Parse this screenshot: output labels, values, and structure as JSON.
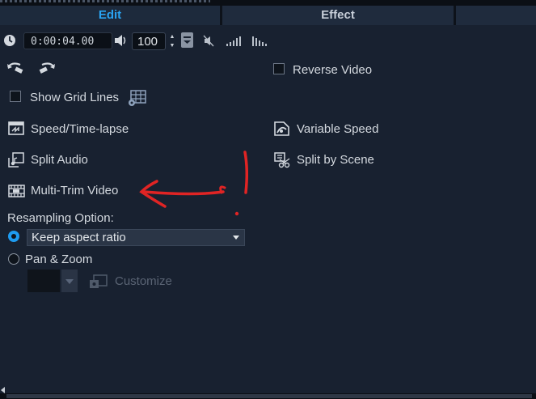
{
  "tabs": [
    {
      "label": "Edit",
      "active": true
    },
    {
      "label": "Effect",
      "active": false
    }
  ],
  "toolbar": {
    "timecode": "0:00:04.00",
    "volume": "100"
  },
  "options": {
    "reverse_video": "Reverse Video",
    "show_grid_lines": "Show Grid Lines",
    "speed_timelapse": "Speed/Time-lapse",
    "variable_speed": "Variable Speed",
    "split_audio": "Split Audio",
    "split_by_scene": "Split by Scene",
    "multi_trim_video": "Multi-Trim Video"
  },
  "resampling": {
    "heading": "Resampling Option:",
    "selected": "Keep aspect ratio",
    "pan_zoom": "Pan & Zoom",
    "customize": "Customize"
  },
  "colors": {
    "accent": "#2aa4f2",
    "background": "#182130",
    "annotation": "#e02424"
  }
}
